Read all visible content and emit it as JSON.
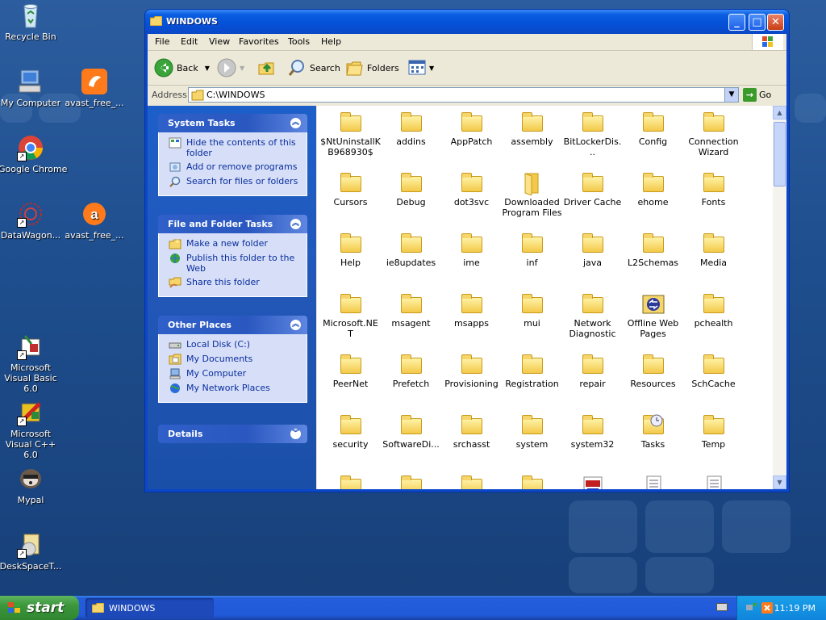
{
  "desktop": {
    "icons": [
      {
        "label": "Recycle Bin"
      },
      {
        "label": "My Computer"
      },
      {
        "label": "avast_free_..."
      },
      {
        "label": "Google Chrome"
      },
      {
        "label": "DataWagon..."
      },
      {
        "label": "avast_free_..."
      },
      {
        "label": "Microsoft Visual Basic 6.0"
      },
      {
        "label": "Microsoft Visual C++ 6.0"
      },
      {
        "label": "Mypal"
      },
      {
        "label": "DeskSpaceT..."
      }
    ]
  },
  "window": {
    "title": "WINDOWS",
    "controls": {
      "minimize": "_",
      "maximize": "□",
      "close": "✕"
    },
    "menu": [
      "File",
      "Edit",
      "View",
      "Favorites",
      "Tools",
      "Help"
    ],
    "toolbar": {
      "back": "Back",
      "search": "Search",
      "folders": "Folders"
    },
    "address": {
      "label": "Address",
      "value": "C:\\WINDOWS",
      "go": "Go"
    },
    "tasks": {
      "system": {
        "title": "System Tasks",
        "items": [
          "Hide the contents of this folder",
          "Add or remove programs",
          "Search for files or folders"
        ]
      },
      "file_folder": {
        "title": "File and Folder Tasks",
        "items": [
          "Make a new folder",
          "Publish this folder to the Web",
          "Share this folder"
        ]
      },
      "other": {
        "title": "Other Places",
        "items": [
          "Local Disk (C:)",
          "My Documents",
          "My Computer",
          "My Network Places"
        ]
      },
      "details": {
        "title": "Details"
      }
    },
    "files": [
      "$NtUninstallKB968930$",
      "addins",
      "AppPatch",
      "assembly",
      "BitLockerDis...",
      "Config",
      "Connection Wizard",
      "Cursors",
      "Debug",
      "dot3svc",
      "Downloaded Program Files",
      "Driver Cache",
      "ehome",
      "Fonts",
      "Help",
      "ie8updates",
      "ime",
      "inf",
      "java",
      "L2Schemas",
      "Media",
      "Microsoft.NET",
      "msagent",
      "msapps",
      "mui",
      "Network Diagnostic",
      "Offline Web Pages",
      "pchealth",
      "PeerNet",
      "Prefetch",
      "Provisioning",
      "Registration",
      "repair",
      "Resources",
      "SchCache",
      "security",
      "SoftwareDi...",
      "srchasst",
      "system",
      "system32",
      "Tasks",
      "Temp"
    ]
  },
  "taskbar": {
    "start": "start",
    "task": "WINDOWS",
    "clock": "11:19 PM"
  }
}
